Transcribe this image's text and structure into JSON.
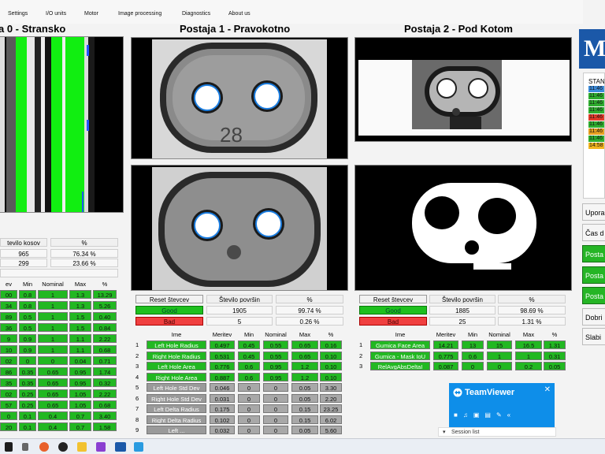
{
  "menu": [
    "Settings",
    "I/O units",
    "Motor",
    "Image processing",
    "Diagnostics",
    "About us"
  ],
  "titles": {
    "p0": "a 0 - Stransko",
    "p1": "Postaja 1 - Pravokotno",
    "p2": "Postaja 2 - Pod Kotom"
  },
  "p0": {
    "head": [
      "tevilo kosov",
      "%"
    ],
    "rows": [
      [
        "965",
        "76.34 %"
      ],
      [
        "299",
        "23.66 %"
      ]
    ],
    "table_header": [
      "ev",
      "Min",
      "Nominal",
      "Max",
      "%"
    ],
    "table_rows": [
      [
        "00",
        "0.8",
        "1",
        "1.3",
        "13.29"
      ],
      [
        "34",
        "0.8",
        "1",
        "1.3",
        "5.26"
      ],
      [
        "89",
        "0.5",
        "1",
        "1.5",
        "0.40"
      ],
      [
        "36",
        "0.5",
        "1",
        "1.5",
        "0.84"
      ],
      [
        "9",
        "0.9",
        "1",
        "1.1",
        "2.22"
      ],
      [
        "10",
        "0.9",
        "1",
        "1.1",
        "0.68"
      ],
      [
        "02",
        "0",
        "0",
        "0.04",
        "0.71"
      ],
      [
        "86",
        "0.35",
        "0.65",
        "0.95",
        "1.74"
      ],
      [
        "35",
        "0.35",
        "0.65",
        "0.95",
        "0.32"
      ],
      [
        "02",
        "0.25",
        "0.65",
        "1.05",
        "2.22"
      ],
      [
        "57",
        "0.25",
        "0.65",
        "1.05",
        "0.68"
      ],
      [
        "0",
        "0.1",
        "0.4",
        "0.7",
        "3.40"
      ],
      [
        "20",
        "0.1",
        "0.4",
        "0.7",
        "1.58"
      ]
    ]
  },
  "p1": {
    "reset": "Reset števcev",
    "count_head": "Število površin",
    "pct_head": "%",
    "good": {
      "label": "Good",
      "count": "1905",
      "pct": "99.74 %"
    },
    "bad": {
      "label": "Bad",
      "count": "5",
      "pct": "0.26 %"
    },
    "table_header": [
      "Ime",
      "Meritev",
      "Min",
      "Nominal",
      "Max",
      "%"
    ],
    "rows": [
      {
        "i": "1",
        "name": "Left Hole Radius",
        "val": "0.497",
        "min": "0.45",
        "nom": "0.55",
        "max": "0.65",
        "pct": "0.16",
        "status": "ok"
      },
      {
        "i": "2",
        "name": "Right Hole Radius",
        "val": "0.531",
        "min": "0.45",
        "nom": "0.55",
        "max": "0.65",
        "pct": "0.10",
        "status": "ok"
      },
      {
        "i": "3",
        "name": "Left Hole Area",
        "val": "0.776",
        "min": "0.6",
        "nom": "0.95",
        "max": "1.2",
        "pct": "0.10",
        "status": "ok"
      },
      {
        "i": "4",
        "name": "Right Hole Area",
        "val": "0.887",
        "min": "0.6",
        "nom": "0.95",
        "max": "1.2",
        "pct": "0.10",
        "status": "ok"
      },
      {
        "i": "5",
        "name": "Left Hole Std Dev",
        "val": "0.046",
        "min": "0",
        "nom": "0",
        "max": "0.05",
        "pct": "3.30",
        "status": "gray"
      },
      {
        "i": "6",
        "name": "Right Hole Std Dev",
        "val": "0.031",
        "min": "0",
        "nom": "0",
        "max": "0.05",
        "pct": "2.20",
        "status": "gray"
      },
      {
        "i": "7",
        "name": "Left Delta Radius",
        "val": "0.175",
        "min": "0",
        "nom": "0",
        "max": "0.15",
        "pct": "23.25",
        "status": "gray"
      },
      {
        "i": "8",
        "name": "Right Delta Radius",
        "val": "0.102",
        "min": "0",
        "nom": "0",
        "max": "0.15",
        "pct": "6.02",
        "status": "gray"
      },
      {
        "i": "9",
        "name": "Left ...",
        "val": "0.032",
        "min": "0",
        "nom": "0",
        "max": "0.05",
        "pct": "5.60",
        "status": "gray"
      }
    ]
  },
  "p2": {
    "reset": "Reset števcev",
    "count_head": "Število površin",
    "pct_head": "%",
    "good": {
      "label": "Good",
      "count": "1885",
      "pct": "98.69 %"
    },
    "bad": {
      "label": "Bad",
      "count": "25",
      "pct": "1.31 %"
    },
    "table_header": [
      "Ime",
      "Meritev",
      "Min",
      "Nominal",
      "Max",
      "%"
    ],
    "rows": [
      {
        "i": "1",
        "name": "Gumica Face Area",
        "val": "14.21",
        "min": "13",
        "nom": "15",
        "max": "16.5",
        "pct": "1.31",
        "status": "ok"
      },
      {
        "i": "2",
        "name": "Gumica - Mask IoU",
        "val": "0.775",
        "min": "0.6",
        "nom": "1",
        "max": "1",
        "pct": "0.31",
        "status": "ok"
      },
      {
        "i": "3",
        "name": "RelAvgAbsDeltaI",
        "val": "0.087",
        "min": "0",
        "nom": "0",
        "max": "0.2",
        "pct": "0.05",
        "status": "ok"
      }
    ]
  },
  "right": {
    "logo": "M",
    "status_title": "STAN",
    "status_lines": [
      "11:46",
      "11:46",
      "11:46",
      "11:46",
      "11:46",
      "11:46",
      "11:46",
      "11:46",
      "14:58"
    ],
    "status_colors": [
      "#3c8cdc",
      "#2fae2f",
      "#2fae2f",
      "#2fae2f",
      "#e33b2a",
      "#2fae2f",
      "#e8a020",
      "#2fae2f",
      "#f2b520"
    ],
    "buttons": [
      "Upora",
      "Čas d",
      "Posta",
      "Posta",
      "Posta",
      "Dobri",
      "Slabi"
    ]
  },
  "teamviewer": {
    "title": "TeamViewer",
    "session": "Session list"
  },
  "colors": {
    "good": "#1ec01e",
    "bad": "#f04040",
    "row_ok": "#22b822",
    "row_gray": "#9a9a9a",
    "accent": "#1b58a8"
  }
}
